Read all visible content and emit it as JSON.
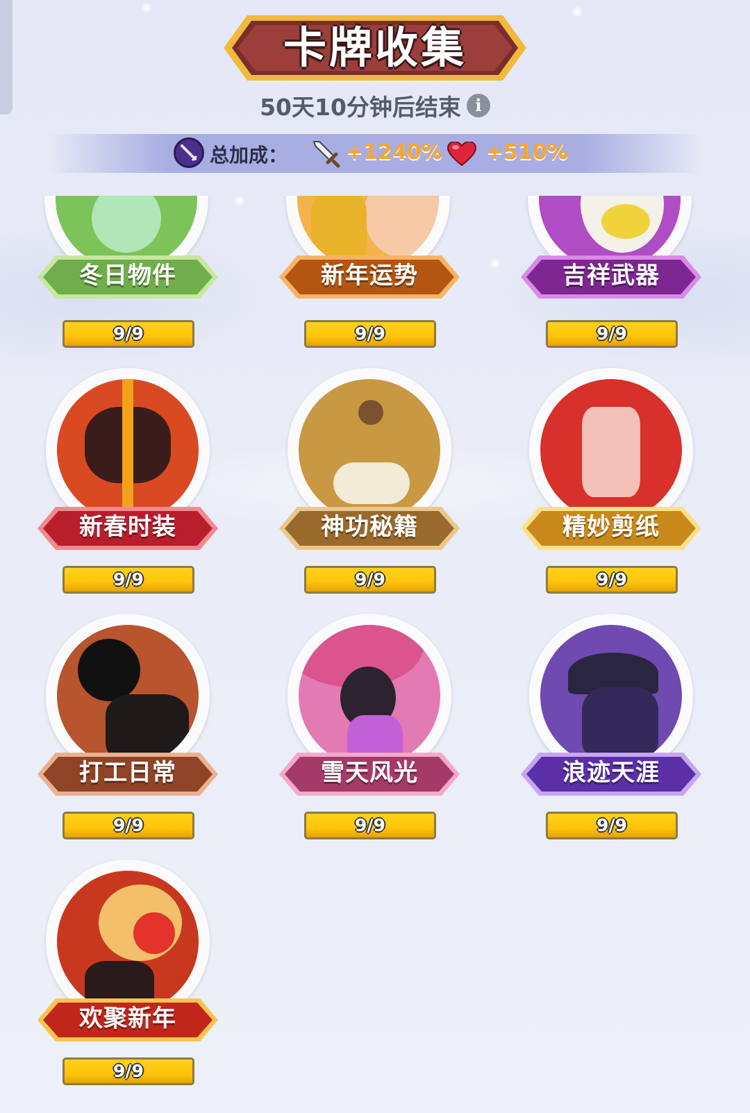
{
  "header": {
    "title": "卡牌收集",
    "timer": "50天10分钟后结束",
    "info_glyph": "i"
  },
  "bonus": {
    "label": "总加成：",
    "attack": "+1240%",
    "health": "+510%",
    "colors": {
      "value": "#f7a62b",
      "bar": "#a9aee2"
    }
  },
  "cards": [
    {
      "name": "冬日物件",
      "progress": "9/9",
      "ribbon_color": "#6fae4b",
      "art_color": "#7cc35a"
    },
    {
      "name": "新年运势",
      "progress": "9/9",
      "ribbon_color": "#e07a1a",
      "art_color": "#f4b34a"
    },
    {
      "name": "吉祥武器",
      "progress": "9/9",
      "ribbon_color": "#a33bb5",
      "art_color": "#b04cc4"
    },
    {
      "name": "新春时装",
      "progress": "9/9",
      "ribbon_color": "#d42b3a",
      "art_color": "#d94a22"
    },
    {
      "name": "神功秘籍",
      "progress": "9/9",
      "ribbon_color": "#b8853e",
      "art_color": "#c99842"
    },
    {
      "name": "精妙剪纸",
      "progress": "9/9",
      "ribbon_color": "#e0a21c",
      "art_color": "#d8302a"
    },
    {
      "name": "打工日常",
      "progress": "9/9",
      "ribbon_color": "#b55f35",
      "art_color": "#b8542e"
    },
    {
      "name": "雪天风光",
      "progress": "9/9",
      "ribbon_color": "#c94f84",
      "art_color": "#e27bb3"
    },
    {
      "name": "浪迹天涯",
      "progress": "9/9",
      "ribbon_color": "#7a4bc7",
      "art_color": "#6f4ab0"
    },
    {
      "name": "欢聚新年",
      "progress": "9/9",
      "ribbon_color": "#d13a22",
      "art_color": "#c8381f"
    }
  ],
  "icons": [
    "info-icon",
    "bonus-sword-badge-icon",
    "sword-icon",
    "heart-icon"
  ]
}
